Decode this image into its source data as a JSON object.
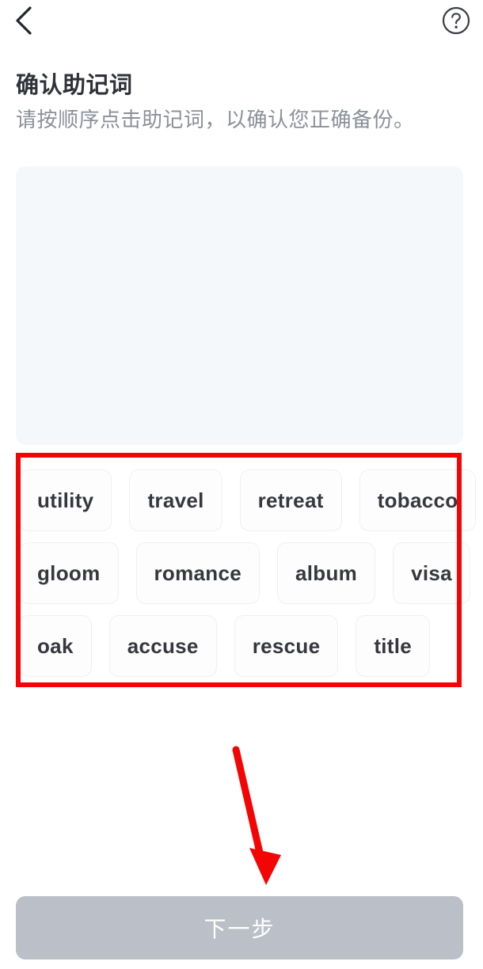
{
  "header": {
    "back_icon": "chevron-left-icon",
    "help_icon": "question-circle-icon"
  },
  "content": {
    "title": "确认助记词",
    "subtitle": "请按顺序点击助记词，以确认您正确备份。",
    "selected_words": []
  },
  "word_bank": {
    "rows": [
      [
        "utility",
        "travel",
        "retreat",
        "tobacco"
      ],
      [
        "gloom",
        "romance",
        "album",
        "visa"
      ],
      [
        "oak",
        "accuse",
        "rescue",
        "title"
      ]
    ]
  },
  "footer": {
    "next_label": "下一步",
    "next_enabled": false
  },
  "annotations": {
    "highlight_color": "#f40505",
    "rect_target": "word-bank",
    "arrow_target": "next-button"
  },
  "colors": {
    "panel_bg": "#f5f8fb",
    "chip_bg": "#fdfdfd",
    "chip_text": "#36383d",
    "title_text": "#2f3237",
    "subtitle_text": "#8b9099",
    "button_bg": "#bbc0c8",
    "button_text": "#ffffff"
  }
}
